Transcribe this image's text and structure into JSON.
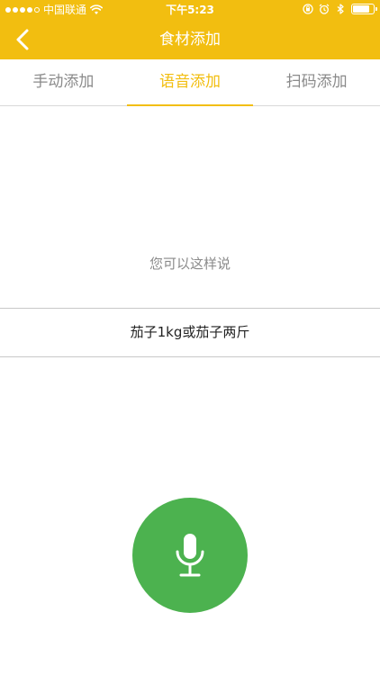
{
  "status_bar": {
    "carrier": "中国联通",
    "time": "下午5:23",
    "battery_level": 0.9
  },
  "nav": {
    "title": "食材添加",
    "back_icon": "chevron-left-icon"
  },
  "tabs": [
    {
      "label": "手动添加",
      "active": false
    },
    {
      "label": "语音添加",
      "active": true
    },
    {
      "label": "扫码添加",
      "active": false
    }
  ],
  "voice": {
    "hint": "您可以这样说",
    "example": "茄子1kg或茄子两斤",
    "mic_icon": "microphone-icon"
  },
  "colors": {
    "accent": "#F2BE10",
    "mic": "#4CB24F",
    "hint_text": "#8a8a8a"
  }
}
